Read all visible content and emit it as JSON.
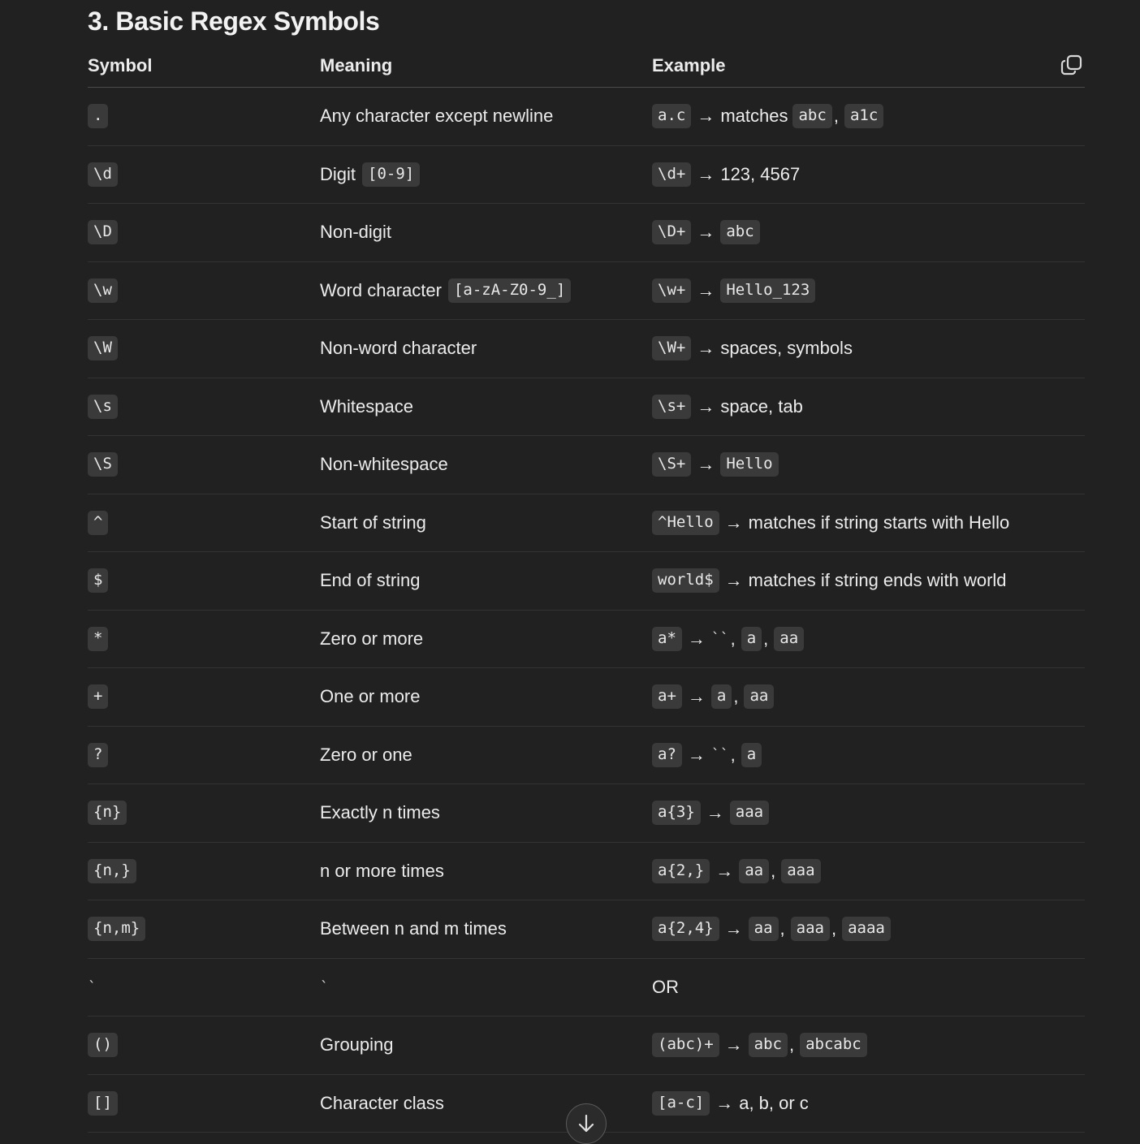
{
  "title": "3. Basic Regex Symbols",
  "table": {
    "headers": [
      "Symbol",
      "Meaning",
      "Example"
    ],
    "rows": [
      {
        "symbol": ".",
        "meaning": [
          {
            "t": "text",
            "v": "Any character except newline"
          }
        ],
        "example": [
          {
            "t": "code",
            "v": "a.c"
          },
          {
            "t": "arrow",
            "v": "→"
          },
          {
            "t": "text",
            "v": "matches"
          },
          {
            "t": "code",
            "v": "abc"
          },
          {
            "t": "sep",
            "v": ","
          },
          {
            "t": "code",
            "v": "a1c"
          }
        ]
      },
      {
        "symbol": "\\d",
        "meaning": [
          {
            "t": "text",
            "v": "Digit"
          },
          {
            "t": "code",
            "v": "[0-9]"
          }
        ],
        "example": [
          {
            "t": "code",
            "v": "\\d+"
          },
          {
            "t": "arrow",
            "v": "→"
          },
          {
            "t": "text",
            "v": "123, 4567"
          }
        ]
      },
      {
        "symbol": "\\D",
        "meaning": [
          {
            "t": "text",
            "v": "Non-digit"
          }
        ],
        "example": [
          {
            "t": "code",
            "v": "\\D+"
          },
          {
            "t": "arrow",
            "v": "→"
          },
          {
            "t": "code",
            "v": "abc"
          }
        ]
      },
      {
        "symbol": "\\w",
        "meaning": [
          {
            "t": "text",
            "v": "Word character"
          },
          {
            "t": "code",
            "v": "[a-zA-Z0-9_]"
          }
        ],
        "example": [
          {
            "t": "code",
            "v": "\\w+"
          },
          {
            "t": "arrow",
            "v": "→"
          },
          {
            "t": "code",
            "v": "Hello_123"
          }
        ]
      },
      {
        "symbol": "\\W",
        "meaning": [
          {
            "t": "text",
            "v": "Non-word character"
          }
        ],
        "example": [
          {
            "t": "code",
            "v": "\\W+"
          },
          {
            "t": "arrow",
            "v": "→"
          },
          {
            "t": "text",
            "v": "spaces, symbols"
          }
        ]
      },
      {
        "symbol": "\\s",
        "meaning": [
          {
            "t": "text",
            "v": "Whitespace"
          }
        ],
        "example": [
          {
            "t": "code",
            "v": "\\s+"
          },
          {
            "t": "arrow",
            "v": "→"
          },
          {
            "t": "text",
            "v": "space, tab"
          }
        ]
      },
      {
        "symbol": "\\S",
        "meaning": [
          {
            "t": "text",
            "v": "Non-whitespace"
          }
        ],
        "example": [
          {
            "t": "code",
            "v": "\\S+"
          },
          {
            "t": "arrow",
            "v": "→"
          },
          {
            "t": "code",
            "v": "Hello"
          }
        ]
      },
      {
        "symbol": "^",
        "meaning": [
          {
            "t": "text",
            "v": "Start of string"
          }
        ],
        "example": [
          {
            "t": "code",
            "v": "^Hello"
          },
          {
            "t": "arrow",
            "v": "→"
          },
          {
            "t": "text",
            "v": "matches if string starts with Hello"
          }
        ]
      },
      {
        "symbol": "$",
        "meaning": [
          {
            "t": "text",
            "v": "End of string"
          }
        ],
        "example": [
          {
            "t": "code",
            "v": "world$"
          },
          {
            "t": "arrow",
            "v": "→"
          },
          {
            "t": "text",
            "v": "matches if string ends with world"
          }
        ]
      },
      {
        "symbol": "*",
        "meaning": [
          {
            "t": "text",
            "v": "Zero or more"
          }
        ],
        "example": [
          {
            "t": "code",
            "v": "a*"
          },
          {
            "t": "arrow",
            "v": "→"
          },
          {
            "t": "tick",
            "v": "``"
          },
          {
            "t": "sep",
            "v": ","
          },
          {
            "t": "code",
            "v": "a"
          },
          {
            "t": "sep",
            "v": ","
          },
          {
            "t": "code",
            "v": "aa"
          }
        ]
      },
      {
        "symbol": "+",
        "meaning": [
          {
            "t": "text",
            "v": "One or more"
          }
        ],
        "example": [
          {
            "t": "code",
            "v": "a+"
          },
          {
            "t": "arrow",
            "v": "→"
          },
          {
            "t": "code",
            "v": "a"
          },
          {
            "t": "sep",
            "v": ","
          },
          {
            "t": "code",
            "v": "aa"
          }
        ]
      },
      {
        "symbol": "?",
        "meaning": [
          {
            "t": "text",
            "v": "Zero or one"
          }
        ],
        "example": [
          {
            "t": "code",
            "v": "a?"
          },
          {
            "t": "arrow",
            "v": "→"
          },
          {
            "t": "tick",
            "v": "``"
          },
          {
            "t": "sep",
            "v": ","
          },
          {
            "t": "code",
            "v": "a"
          }
        ]
      },
      {
        "symbol": "{n}",
        "meaning": [
          {
            "t": "text",
            "v": "Exactly n times"
          }
        ],
        "example": [
          {
            "t": "code",
            "v": "a{3}"
          },
          {
            "t": "arrow",
            "v": "→"
          },
          {
            "t": "code",
            "v": "aaa"
          }
        ]
      },
      {
        "symbol": "{n,}",
        "meaning": [
          {
            "t": "text",
            "v": "n or more times"
          }
        ],
        "example": [
          {
            "t": "code",
            "v": "a{2,}"
          },
          {
            "t": "arrow",
            "v": "→"
          },
          {
            "t": "code",
            "v": "aa"
          },
          {
            "t": "sep",
            "v": ","
          },
          {
            "t": "code",
            "v": "aaa"
          }
        ]
      },
      {
        "symbol": "{n,m}",
        "meaning": [
          {
            "t": "text",
            "v": "Between n and m times"
          }
        ],
        "example": [
          {
            "t": "code",
            "v": "a{2,4}"
          },
          {
            "t": "arrow",
            "v": "→"
          },
          {
            "t": "code",
            "v": "aa"
          },
          {
            "t": "sep",
            "v": ","
          },
          {
            "t": "code",
            "v": "aaa"
          },
          {
            "t": "sep",
            "v": ","
          },
          {
            "t": "code",
            "v": "aaaa"
          }
        ]
      },
      {
        "symbol_plain": "`",
        "meaning": [
          {
            "t": "plaintick",
            "v": "`"
          }
        ],
        "example": [
          {
            "t": "text",
            "v": "OR"
          }
        ]
      },
      {
        "symbol": "()",
        "meaning": [
          {
            "t": "text",
            "v": "Grouping"
          }
        ],
        "example": [
          {
            "t": "code",
            "v": "(abc)+"
          },
          {
            "t": "arrow",
            "v": "→"
          },
          {
            "t": "code",
            "v": "abc"
          },
          {
            "t": "sep",
            "v": ","
          },
          {
            "t": "code",
            "v": "abcabc"
          }
        ]
      },
      {
        "symbol": "[]",
        "meaning": [
          {
            "t": "text",
            "v": "Character class"
          }
        ],
        "example": [
          {
            "t": "code",
            "v": "[a-c]"
          },
          {
            "t": "arrow",
            "v": "→"
          },
          {
            "t": "text",
            "v": "a, b, or c"
          }
        ]
      }
    ]
  },
  "icons": {
    "copy": "copy-icon",
    "scroll_down": "arrow-down-icon"
  },
  "colors": {
    "background": "#212121",
    "code_bg": "#3a3a3a",
    "text": "#ececec",
    "divider": "#333333"
  }
}
